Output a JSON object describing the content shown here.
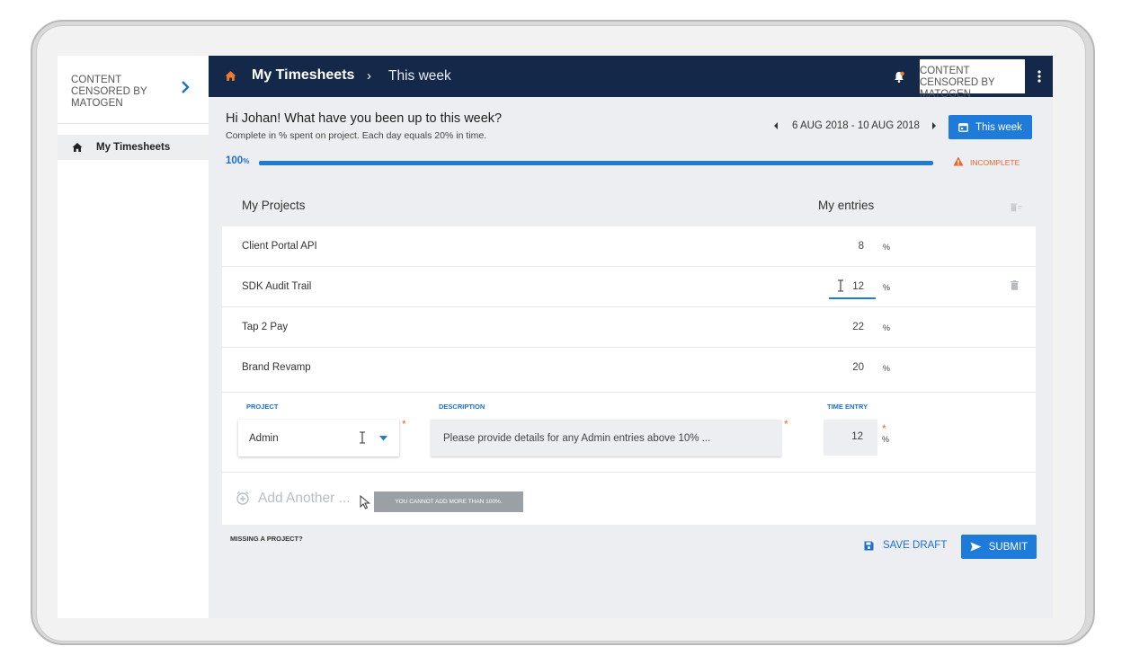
{
  "sidebar": {
    "brand": "CONTENT CENSORED BY MATOGEN",
    "items": [
      {
        "label": "My Timesheets",
        "icon": "home-icon"
      }
    ]
  },
  "topbar": {
    "title": "My Timesheets",
    "separator": "›",
    "subtitle": "This week",
    "brand": "CONTENT CENSORED BY MATOGEN"
  },
  "greeting": {
    "title": "Hi Johan! What have you been up to this week?",
    "subtitle": "Complete in % spent on project. Each day equals 20% in time."
  },
  "week": {
    "range": "6 AUG 2018 - 10 AUG 2018",
    "button_label": "This week"
  },
  "progress": {
    "value": "100",
    "unit": "%",
    "fraction": 1.0,
    "status": "INCOMPLETE"
  },
  "projects": {
    "header_name": "My Projects",
    "header_entries": "My entries",
    "rows": [
      {
        "name": "Client Portal API",
        "value": "8",
        "unit": "%"
      },
      {
        "name": "SDK Audit Trail",
        "value": "12",
        "unit": "%"
      },
      {
        "name": "Tap 2 Pay",
        "value": "22",
        "unit": "%"
      },
      {
        "name": "Brand Revamp",
        "value": "20",
        "unit": "%"
      }
    ]
  },
  "form": {
    "project_label": "PROJECT",
    "project_value": "Admin",
    "description_label": "DESCRIPTION",
    "description_placeholder": "Please provide details for any Admin entries above 10% ...",
    "time_label": "TIME ENTRY",
    "time_value": "12",
    "time_unit": "%",
    "required_mark": "*"
  },
  "add_another": {
    "label": "Add Another ...",
    "tooltip": "YOU CANNOT ADD MORE THAN 100%."
  },
  "footer": {
    "missing": "MISSING A PROJECT?",
    "save_draft": "SAVE DRAFT",
    "submit": "SUBMIT"
  },
  "colors": {
    "navy": "#14284a",
    "accent": "#1e7bd9",
    "warning": "#e8692c"
  }
}
